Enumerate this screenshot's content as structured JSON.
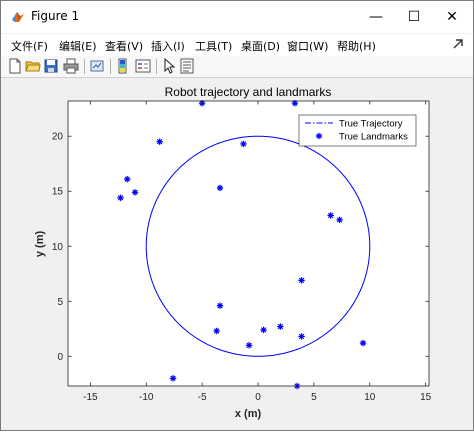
{
  "window": {
    "title": "Figure 1",
    "minimize_glyph": "—",
    "maximize_glyph": "☐",
    "close_glyph": "✕"
  },
  "menu": {
    "items": [
      "文件(F)",
      "编辑(E)",
      "查看(V)",
      "插入(I)",
      "工具(T)",
      "桌面(D)",
      "窗口(W)",
      "帮助(H)"
    ]
  },
  "toolbar": {
    "icons": [
      "new-figure-icon",
      "open-file-icon",
      "save-icon",
      "print-icon",
      "link-plot-icon",
      "colorbar-icon",
      "legend-icon",
      "pointer-icon",
      "property-inspector-icon"
    ]
  },
  "colors": {
    "series": "#0000ff",
    "axes": "#262626"
  },
  "chart_data": {
    "type": "line",
    "title": "Robot trajectory and landmarks",
    "xlabel": "x (m)",
    "ylabel": "y (m)",
    "xlim": [
      -17,
      15.3
    ],
    "ylim": [
      -2.7,
      23.2
    ],
    "xticks": [
      -15,
      -10,
      -5,
      0,
      5,
      10,
      15
    ],
    "yticks": [
      0,
      5,
      10,
      15,
      20
    ],
    "grid": false,
    "legend_position": "top-right",
    "series": [
      {
        "name": "True Trajectory",
        "style": "dash-dot line",
        "color": "#0000ff",
        "shape": "circle",
        "center": [
          0,
          10
        ],
        "radius": 10
      },
      {
        "name": "True Landmarks",
        "style": "asterisk markers",
        "color": "#0000ff",
        "points": [
          [
            -5.0,
            23.0
          ],
          [
            3.3,
            23.0
          ],
          [
            -8.8,
            19.5
          ],
          [
            -1.3,
            19.3
          ],
          [
            -11.7,
            16.1
          ],
          [
            -11.0,
            14.9
          ],
          [
            -12.3,
            14.4
          ],
          [
            -3.4,
            15.3
          ],
          [
            6.5,
            12.8
          ],
          [
            7.3,
            12.4
          ],
          [
            3.9,
            6.9
          ],
          [
            -3.4,
            4.6
          ],
          [
            2.0,
            2.7
          ],
          [
            0.5,
            2.4
          ],
          [
            -3.7,
            2.3
          ],
          [
            3.9,
            1.8
          ],
          [
            9.4,
            1.2
          ],
          [
            -0.8,
            1.0
          ],
          [
            -7.6,
            -2.0
          ],
          [
            3.5,
            -2.7
          ]
        ]
      }
    ]
  }
}
